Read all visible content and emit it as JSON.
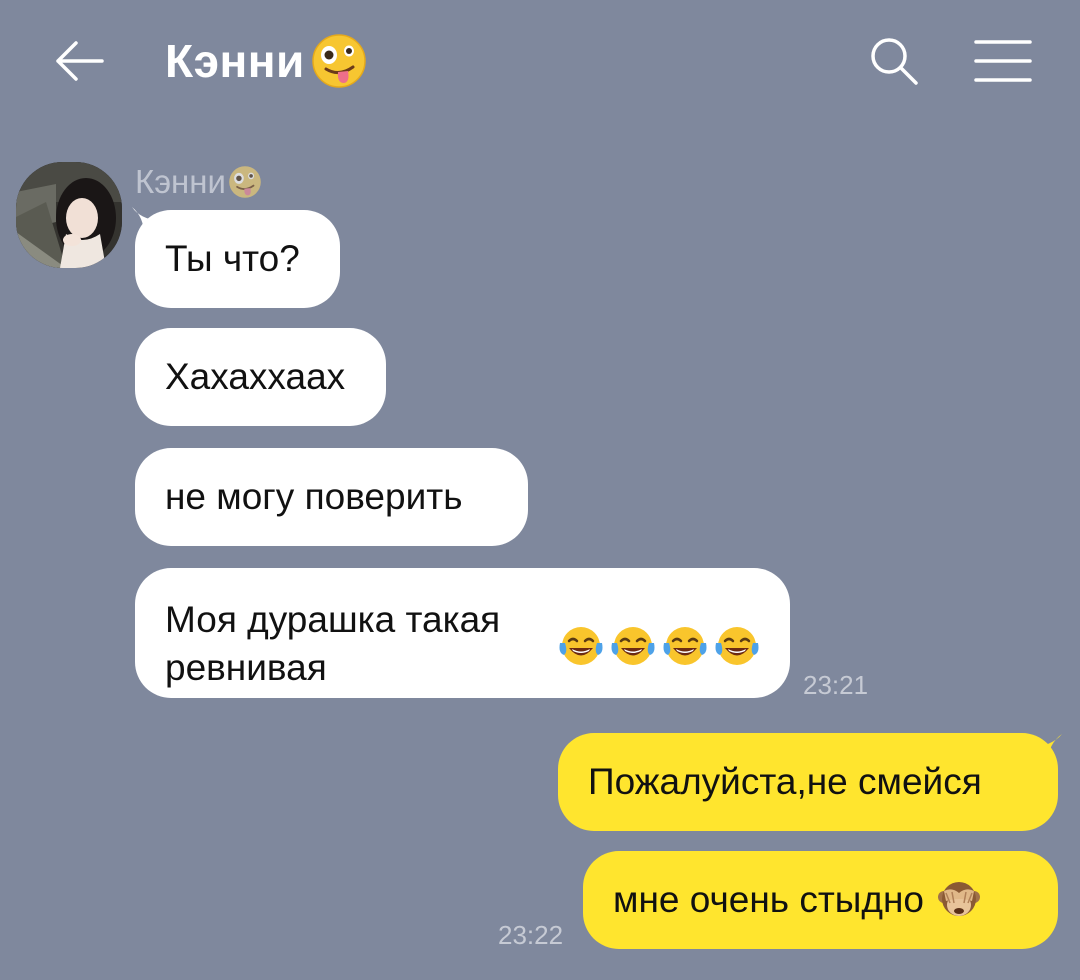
{
  "header": {
    "title": "Кэнни",
    "title_emoji": "zany-face-emoji",
    "back_icon": "arrow-left-icon",
    "search_icon": "search-icon",
    "menu_icon": "hamburger-menu-icon"
  },
  "incoming": {
    "sender_name": "Кэнни",
    "sender_emoji": "zany-face-emoji",
    "avatar": "contact-avatar",
    "messages": [
      {
        "text": "Ты что?"
      },
      {
        "text": "Хахаххаах"
      },
      {
        "text": "не могу поверить"
      },
      {
        "text": "Моя дурашка такая ревнивая",
        "emoji": "tears-of-joy-emoji",
        "emoji_count": 4
      }
    ],
    "time": "23:21"
  },
  "outgoing": {
    "messages": [
      {
        "text": "Пожалуйста,не смейся"
      },
      {
        "text": "мне очень стыдно",
        "emoji": "see-no-evil-monkey-emoji"
      }
    ],
    "time": "23:22"
  },
  "colors": {
    "background": "#7f889d",
    "incoming_bubble": "#ffffff",
    "outgoing_bubble": "#ffe52e",
    "timestamp": "#c6cad4"
  }
}
